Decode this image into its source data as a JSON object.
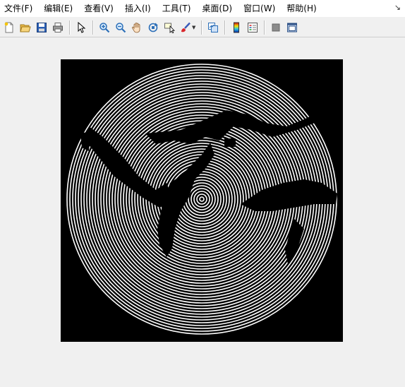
{
  "menubar": {
    "items": [
      {
        "label": "文件(F)"
      },
      {
        "label": "编辑(E)"
      },
      {
        "label": "查看(V)"
      },
      {
        "label": "插入(I)"
      },
      {
        "label": "工具(T)"
      },
      {
        "label": "桌面(D)"
      },
      {
        "label": "窗口(W)"
      },
      {
        "label": "帮助(H)"
      }
    ],
    "dock_icon": "↘"
  },
  "toolbar": {
    "buttons": [
      "new-figure-icon",
      "open-file-icon",
      "save-icon",
      "print-icon",
      "edit-plot-arrow-icon",
      "zoom-in-icon",
      "zoom-out-icon",
      "pan-hand-icon",
      "rotate-3d-icon",
      "data-cursor-icon",
      "brush-icon",
      "link-plot-icon",
      "insert-colorbar-icon",
      "insert-legend-icon",
      "hide-plot-tools-icon",
      "show-plot-tools-icon"
    ]
  },
  "figure": {
    "image": "concentric-ring halftone rendering of a face/bird silhouette on black background",
    "colors": {
      "background": "#000000",
      "rings": "#ffffff"
    }
  }
}
